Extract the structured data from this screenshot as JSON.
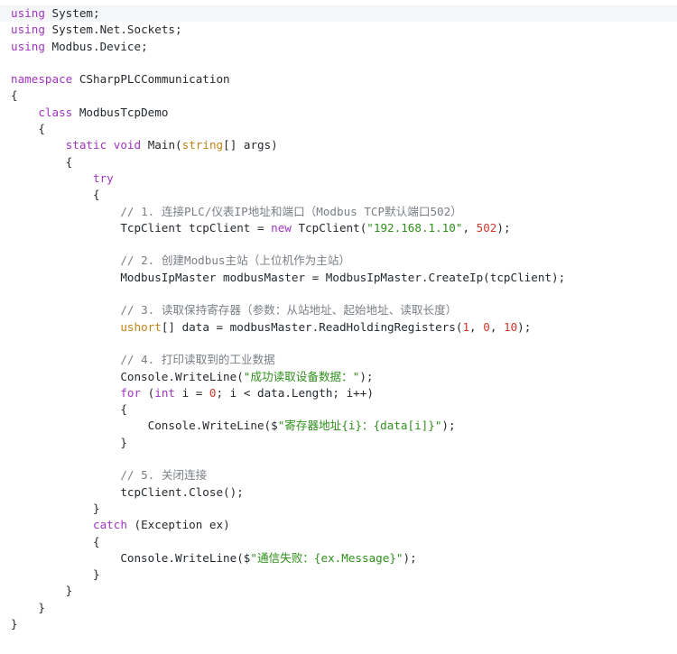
{
  "editor": {
    "language": "csharp",
    "colors": {
      "background": "#ffffff",
      "first_line_highlight": "#f5f6f8",
      "plain": "#24292e",
      "keyword": "#a035c0",
      "type": "#c08417",
      "string": "#2f8f1b",
      "number": "#cc3a2c",
      "comment": "#7a7f86"
    },
    "lines": [
      [
        {
          "t": "kw",
          "v": "using"
        },
        {
          "t": "plain",
          "v": " System;"
        }
      ],
      [
        {
          "t": "kw",
          "v": "using"
        },
        {
          "t": "plain",
          "v": " System.Net.Sockets;"
        }
      ],
      [
        {
          "t": "kw",
          "v": "using"
        },
        {
          "t": "plain",
          "v": " Modbus.Device;"
        }
      ],
      [],
      [
        {
          "t": "kw",
          "v": "namespace"
        },
        {
          "t": "plain",
          "v": " CSharpPLCCommunication"
        }
      ],
      [
        {
          "t": "plain",
          "v": "{"
        }
      ],
      [
        {
          "t": "plain",
          "v": "    "
        },
        {
          "t": "kw",
          "v": "class"
        },
        {
          "t": "plain",
          "v": " ModbusTcpDemo"
        }
      ],
      [
        {
          "t": "plain",
          "v": "    {"
        }
      ],
      [
        {
          "t": "plain",
          "v": "        "
        },
        {
          "t": "kw",
          "v": "static"
        },
        {
          "t": "plain",
          "v": " "
        },
        {
          "t": "kw",
          "v": "void"
        },
        {
          "t": "plain",
          "v": " Main("
        },
        {
          "t": "type",
          "v": "string"
        },
        {
          "t": "plain",
          "v": "[] args)"
        }
      ],
      [
        {
          "t": "plain",
          "v": "        {"
        }
      ],
      [
        {
          "t": "plain",
          "v": "            "
        },
        {
          "t": "kw",
          "v": "try"
        }
      ],
      [
        {
          "t": "plain",
          "v": "            {"
        }
      ],
      [
        {
          "t": "plain",
          "v": "                "
        },
        {
          "t": "cm",
          "v": "// 1. 连接PLC/仪表IP地址和端口（Modbus TCP默认端口502）"
        }
      ],
      [
        {
          "t": "plain",
          "v": "                TcpClient tcpClient = "
        },
        {
          "t": "kw",
          "v": "new"
        },
        {
          "t": "plain",
          "v": " TcpClient("
        },
        {
          "t": "str",
          "v": "\"192.168.1.10\""
        },
        {
          "t": "plain",
          "v": ", "
        },
        {
          "t": "num",
          "v": "502"
        },
        {
          "t": "plain",
          "v": ");"
        }
      ],
      [],
      [
        {
          "t": "plain",
          "v": "                "
        },
        {
          "t": "cm",
          "v": "// 2. 创建Modbus主站（上位机作为主站）"
        }
      ],
      [
        {
          "t": "plain",
          "v": "                ModbusIpMaster modbusMaster = ModbusIpMaster.CreateIp(tcpClient);"
        }
      ],
      [],
      [
        {
          "t": "plain",
          "v": "                "
        },
        {
          "t": "cm",
          "v": "// 3. 读取保持寄存器（参数：从站地址、起始地址、读取长度）"
        }
      ],
      [
        {
          "t": "plain",
          "v": "                "
        },
        {
          "t": "type",
          "v": "ushort"
        },
        {
          "t": "plain",
          "v": "[] data = modbusMaster.ReadHoldingRegisters("
        },
        {
          "t": "num",
          "v": "1"
        },
        {
          "t": "plain",
          "v": ", "
        },
        {
          "t": "num",
          "v": "0"
        },
        {
          "t": "plain",
          "v": ", "
        },
        {
          "t": "num",
          "v": "10"
        },
        {
          "t": "plain",
          "v": ");"
        }
      ],
      [],
      [
        {
          "t": "plain",
          "v": "                "
        },
        {
          "t": "cm",
          "v": "// 4. 打印读取到的工业数据"
        }
      ],
      [
        {
          "t": "plain",
          "v": "                Console.WriteLine("
        },
        {
          "t": "str",
          "v": "\"成功读取设备数据：\""
        },
        {
          "t": "plain",
          "v": ");"
        }
      ],
      [
        {
          "t": "plain",
          "v": "                "
        },
        {
          "t": "kw",
          "v": "for"
        },
        {
          "t": "plain",
          "v": " ("
        },
        {
          "t": "kw",
          "v": "int"
        },
        {
          "t": "plain",
          "v": " i = "
        },
        {
          "t": "num",
          "v": "0"
        },
        {
          "t": "plain",
          "v": "; i < data.Length; i++)"
        }
      ],
      [
        {
          "t": "plain",
          "v": "                {"
        }
      ],
      [
        {
          "t": "plain",
          "v": "                    Console.WriteLine($"
        },
        {
          "t": "str",
          "v": "\"寄存器地址{i}：{data[i]}\""
        },
        {
          "t": "plain",
          "v": ");"
        }
      ],
      [
        {
          "t": "plain",
          "v": "                }"
        }
      ],
      [],
      [
        {
          "t": "plain",
          "v": "                "
        },
        {
          "t": "cm",
          "v": "// 5. 关闭连接"
        }
      ],
      [
        {
          "t": "plain",
          "v": "                tcpClient.Close();"
        }
      ],
      [
        {
          "t": "plain",
          "v": "            }"
        }
      ],
      [
        {
          "t": "plain",
          "v": "            "
        },
        {
          "t": "kw",
          "v": "catch"
        },
        {
          "t": "plain",
          "v": " (Exception ex)"
        }
      ],
      [
        {
          "t": "plain",
          "v": "            {"
        }
      ],
      [
        {
          "t": "plain",
          "v": "                Console.WriteLine($"
        },
        {
          "t": "str",
          "v": "\"通信失败：{ex.Message}\""
        },
        {
          "t": "plain",
          "v": ");"
        }
      ],
      [
        {
          "t": "plain",
          "v": "            }"
        }
      ],
      [
        {
          "t": "plain",
          "v": "        }"
        }
      ],
      [
        {
          "t": "plain",
          "v": "    }"
        }
      ],
      [
        {
          "t": "plain",
          "v": "}"
        }
      ]
    ]
  }
}
